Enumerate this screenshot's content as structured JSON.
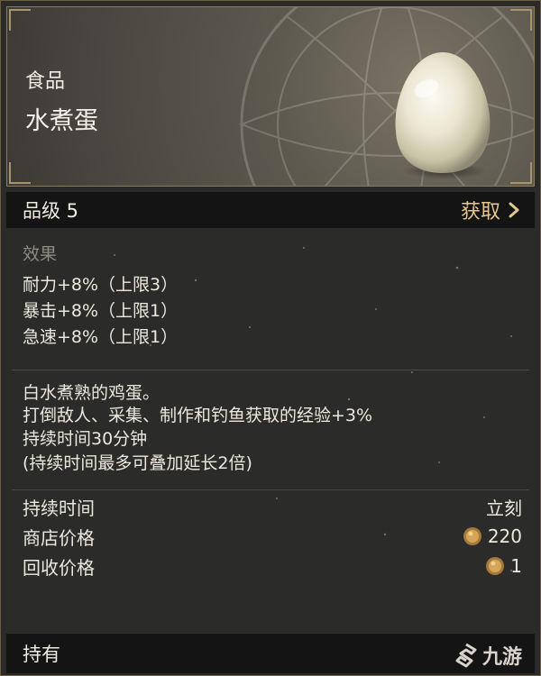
{
  "header": {
    "category": "食品",
    "item_name": "水煮蛋",
    "item_icon": "boiled-egg-icon"
  },
  "grade_bar": {
    "grade": "品级 5",
    "obtain_label": "获取"
  },
  "effects": {
    "label": "效果",
    "items": [
      "耐力+8%（上限3）",
      "暴击+8%（上限1）",
      "急速+8%（上限1）"
    ]
  },
  "description": {
    "lines": [
      "白水煮熟的鸡蛋。",
      "打倒敌人、采集、制作和钓鱼获取的经验+3%",
      "持续时间30分钟",
      "(持续时间最多可叠加延长2倍)"
    ]
  },
  "stats": [
    {
      "label": "持续时间",
      "value": "立刻"
    },
    {
      "label": "商店价格",
      "value": "220",
      "icon": "gold-coin-icon"
    },
    {
      "label": "回收价格",
      "value": "1",
      "icon": "gold-coin-icon"
    }
  ],
  "footer": {
    "owned_label": "持有",
    "watermark": "九游"
  },
  "colors": {
    "accent_gold": "#e3c78e",
    "frame_gold": "#8a7b5c",
    "text": "#ece8de",
    "muted": "#8e8a82"
  }
}
